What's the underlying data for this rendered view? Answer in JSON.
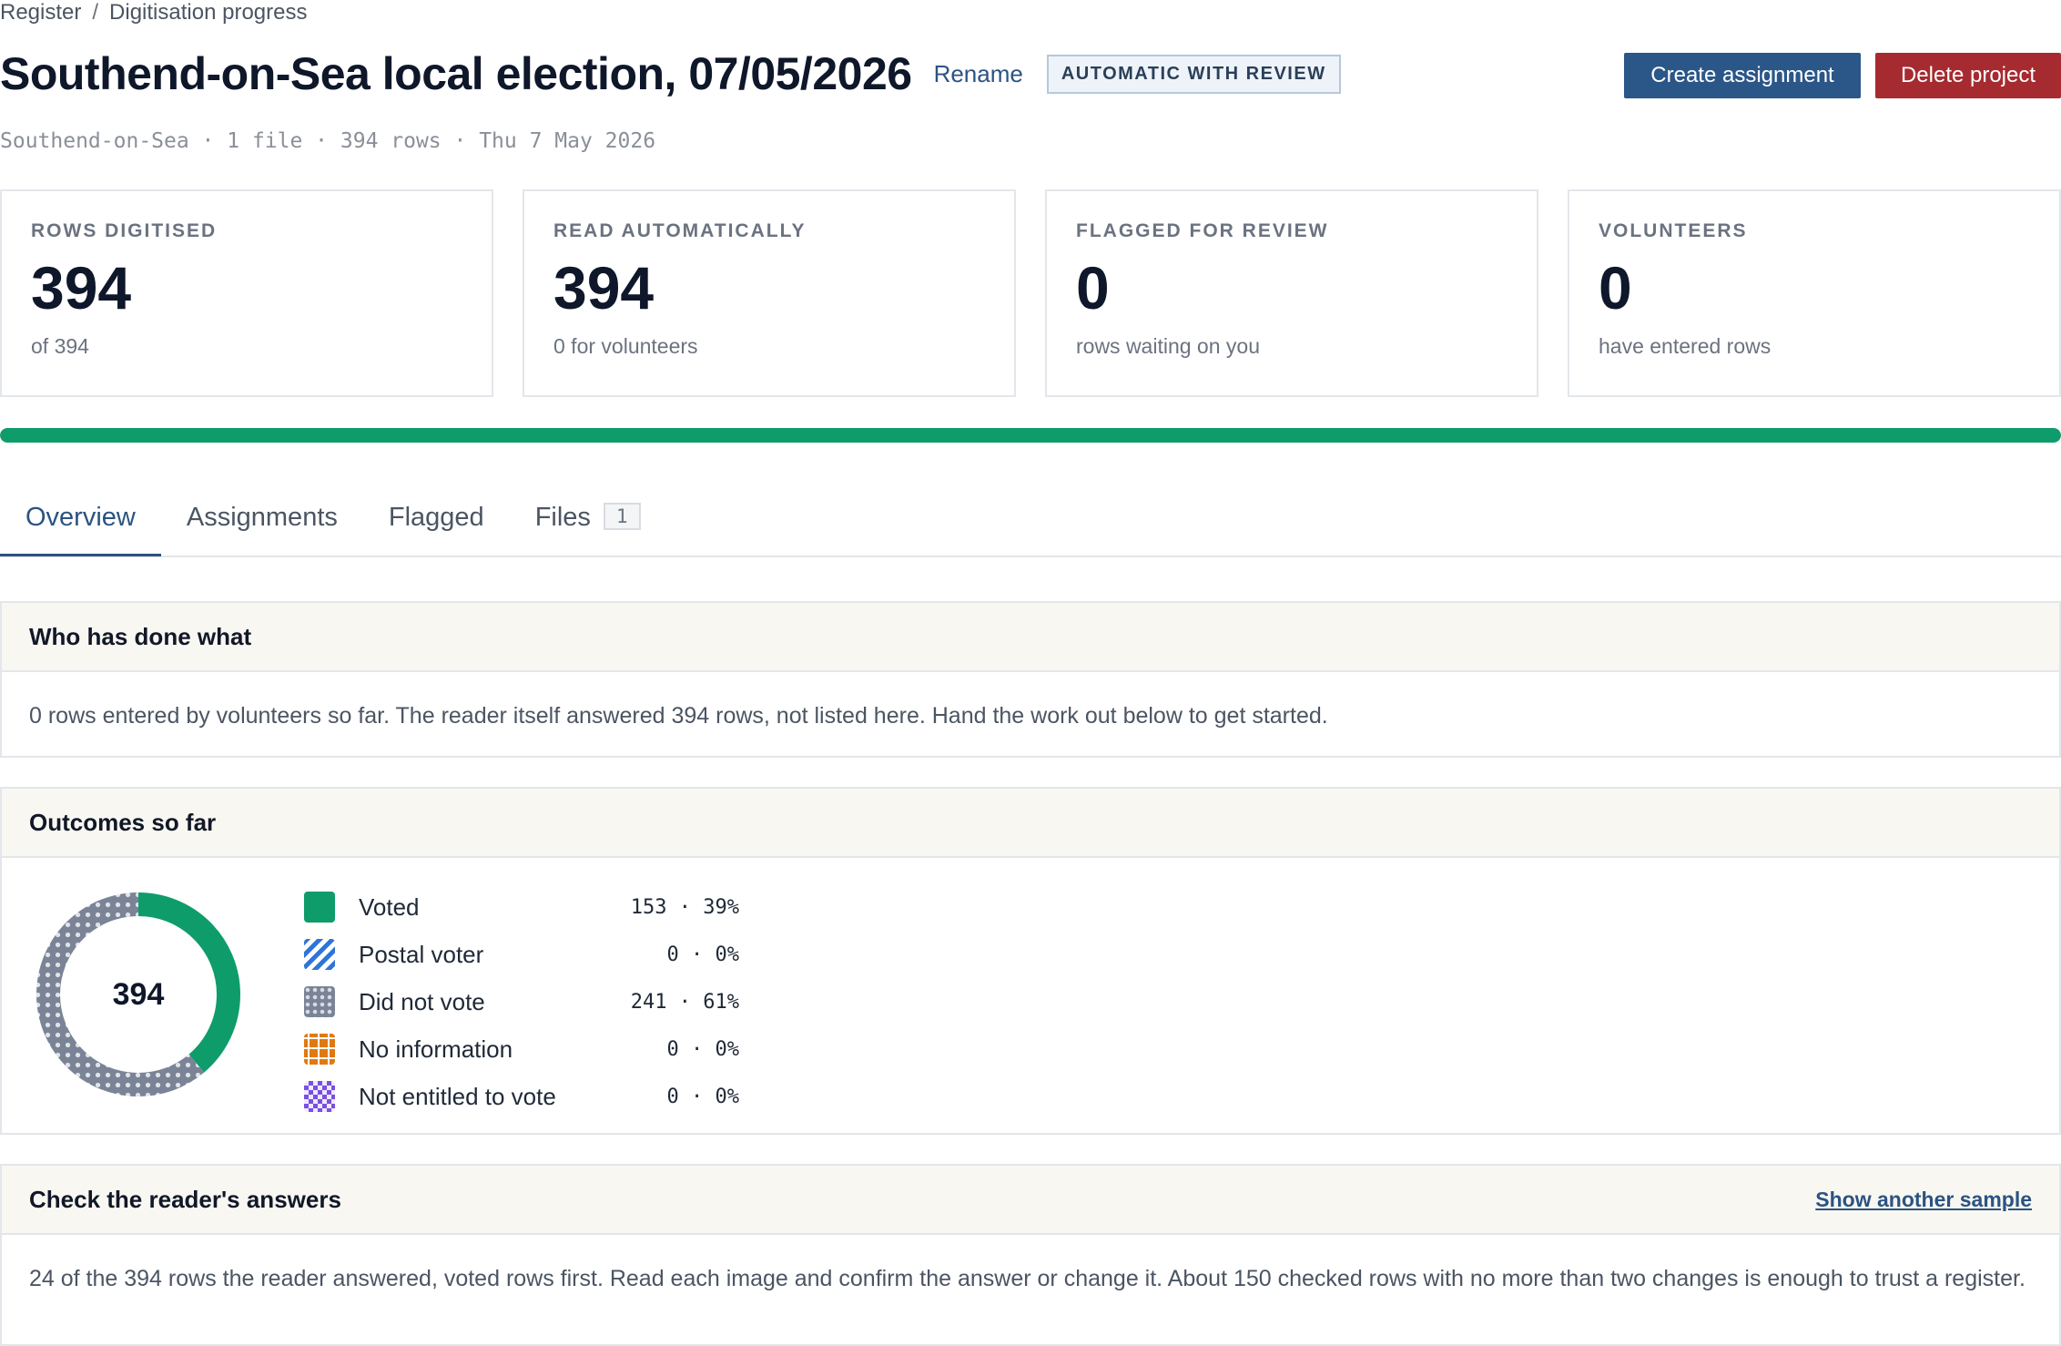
{
  "breadcrumb": {
    "root": "Register",
    "separator": "/",
    "current": "Digitisation progress"
  },
  "header": {
    "title": "Southend-on-Sea local election, 07/05/2026",
    "rename_label": "Rename",
    "mode_badge": "AUTOMATIC WITH REVIEW",
    "create_label": "Create assignment",
    "delete_label": "Delete project",
    "meta": "Southend-on-Sea · 1 file · 394 rows · Thu 7 May 2026"
  },
  "stats": [
    {
      "label": "ROWS DIGITISED",
      "value": "394",
      "sub": "of 394"
    },
    {
      "label": "READ AUTOMATICALLY",
      "value": "394",
      "sub": "0 for volunteers"
    },
    {
      "label": "FLAGGED FOR REVIEW",
      "value": "0",
      "sub": "rows waiting on you"
    },
    {
      "label": "VOLUNTEERS",
      "value": "0",
      "sub": "have entered rows"
    }
  ],
  "progress": {
    "fraction": 1.0,
    "color": "#0e9c6b"
  },
  "tabs": [
    {
      "label": "Overview",
      "active": true
    },
    {
      "label": "Assignments"
    },
    {
      "label": "Flagged"
    },
    {
      "label": "Files",
      "count": "1"
    }
  ],
  "who_panel": {
    "title": "Who has done what",
    "body": "0 rows entered by volunteers so far. The reader itself answered 394 rows, not listed here. Hand the work out below to get started."
  },
  "outcomes_panel": {
    "title": "Outcomes so far",
    "total": "394",
    "items": [
      {
        "label": "Voted",
        "count": 153,
        "display": "153 · 39%",
        "color": "#0e9c6b"
      },
      {
        "label": "Postal voter",
        "count": 0,
        "display": "0 · 0%",
        "color": "#2f74d8"
      },
      {
        "label": "Did not vote",
        "count": 241,
        "display": "241 · 61%",
        "color": "#7b8496"
      },
      {
        "label": "No information",
        "count": 0,
        "display": "0 · 0%",
        "color": "#e07a10"
      },
      {
        "label": "Not entitled to vote",
        "count": 0,
        "display": "0 · 0%",
        "color": "#7b4fe0"
      }
    ]
  },
  "check_panel": {
    "title": "Check the reader's answers",
    "link_label": "Show another sample",
    "body": "24 of the 394 rows the reader answered, voted rows first. Read each image and confirm the answer or change it. About 150 checked rows with no more than two changes is enough to trust a register."
  }
}
